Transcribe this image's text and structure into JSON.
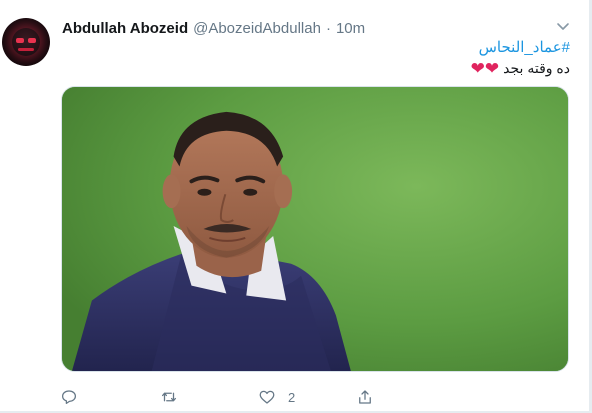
{
  "tweet": {
    "author": {
      "display_name": "Abdullah Abozeid",
      "handle": "@AbozeidAbdullah",
      "separator": "·",
      "time": "10m"
    },
    "text": {
      "hashtag": "#عماد_النحاس",
      "line2": "ده وقته بجد",
      "hearts": [
        "❤",
        "❤"
      ]
    },
    "media": {
      "alt_icon": "photo-of-man-in-tracksuit",
      "background_color": "#5a9b41"
    },
    "actions": {
      "reply_count": "",
      "retweet_count": "",
      "like_count": "2",
      "share_label": ""
    }
  },
  "colors": {
    "link": "#1b95e0",
    "secondary_text": "#657786",
    "heart": "#e0245e",
    "primary_text": "#14171a"
  }
}
